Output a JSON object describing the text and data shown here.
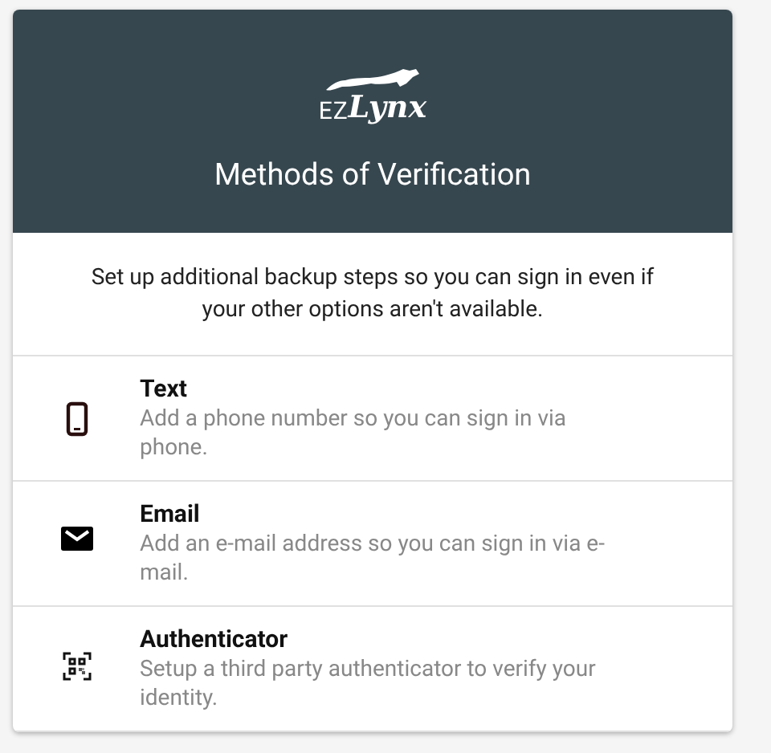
{
  "header": {
    "logo": {
      "prefix": "EZ",
      "name": "Lynx"
    },
    "title": "Methods of Verification"
  },
  "intro": "Set up additional backup steps so you can sign in even if your other options aren't available.",
  "methods": [
    {
      "kind": "phone",
      "title": "Text",
      "description": "Add a phone number so you can sign in via phone."
    },
    {
      "kind": "email",
      "title": "Email",
      "description": "Add an e-mail address so you can sign in via e-mail."
    },
    {
      "kind": "authenticator",
      "title": "Authenticator",
      "description": "Setup a third party authenticator to verify your identity."
    }
  ]
}
